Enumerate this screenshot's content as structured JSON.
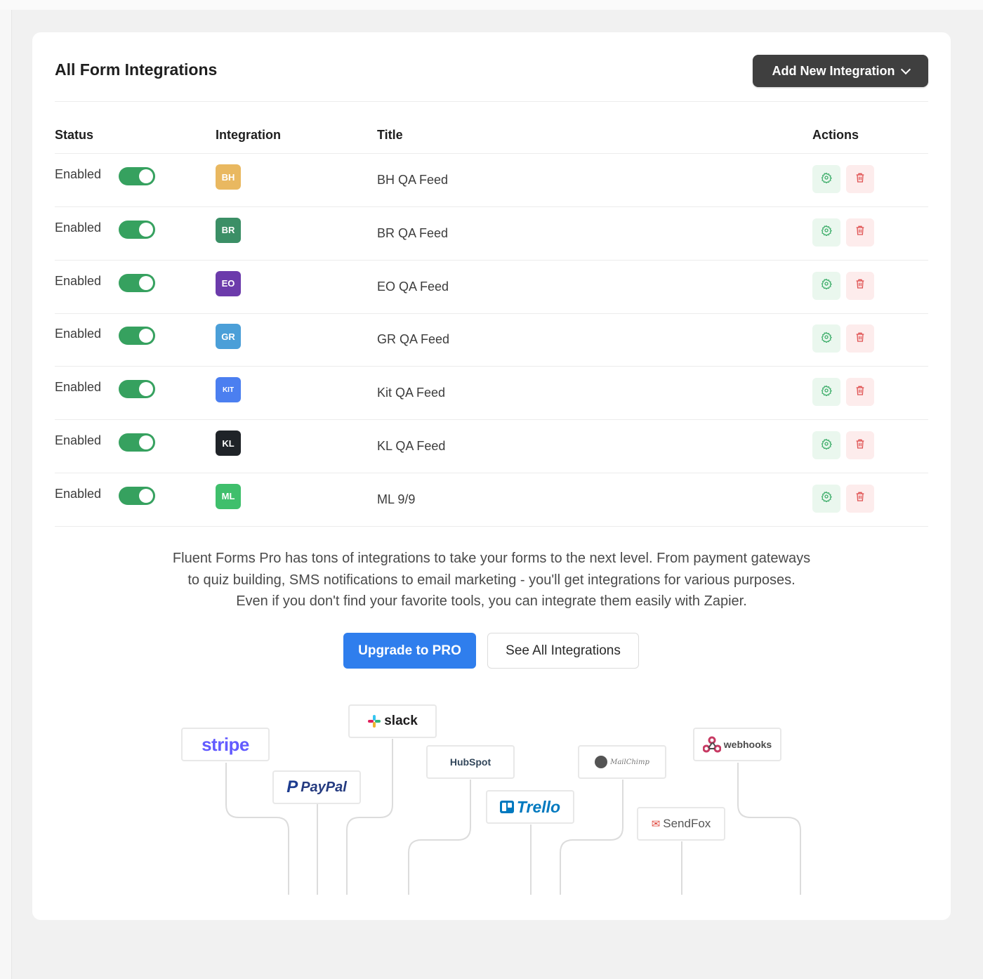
{
  "header": {
    "title": "All Form Integrations",
    "add_button_label": "Add New Integration"
  },
  "table": {
    "columns": [
      "Status",
      "Integration",
      "Title",
      "Actions"
    ],
    "rows": [
      {
        "status": "Enabled",
        "badge": "BH",
        "badge_color": "#e9b860",
        "title": "BH QA Feed"
      },
      {
        "status": "Enabled",
        "badge": "BR",
        "badge_color": "#3b8f66",
        "title": "BR QA Feed"
      },
      {
        "status": "Enabled",
        "badge": "EO",
        "badge_color": "#6c3bab",
        "title": "EO QA Feed"
      },
      {
        "status": "Enabled",
        "badge": "GR",
        "badge_color": "#4b9fd8",
        "title": "GR QA Feed"
      },
      {
        "status": "Enabled",
        "badge": "KIT",
        "badge_color": "#4b7ff0",
        "title": "Kit QA Feed"
      },
      {
        "status": "Enabled",
        "badge": "KL",
        "badge_color": "#1f2328",
        "title": "KL QA Feed"
      },
      {
        "status": "Enabled",
        "badge": "ML",
        "badge_color": "#3fbf6c",
        "title": "ML 9/9"
      }
    ],
    "action_icons": [
      "gear-icon",
      "trash-icon"
    ]
  },
  "promo": {
    "lines": [
      "Fluent Forms Pro has tons of integrations to take your forms to the next level. From payment gateways",
      "to quiz building, SMS notifications to email marketing - you'll get integrations for various purposes.",
      "Even if you don't find your favorite tools, you can integrate them easily with Zapier."
    ],
    "upgrade_label": "Upgrade to PRO",
    "see_all_label": "See All Integrations"
  },
  "logos": {
    "stripe": "stripe",
    "paypal": "PayPal",
    "slack": "slack",
    "hubspot": "HubSpot",
    "trello": "Trello",
    "mailchimp": "MailChimp",
    "sendfox": "SendFox",
    "webhooks": "webhooks"
  },
  "colors": {
    "toggle_on": "#36a15f",
    "primary": "#2f7eed",
    "dark_button": "#3f3f3f",
    "gear": "#3fae6b",
    "trash": "#e05252"
  }
}
